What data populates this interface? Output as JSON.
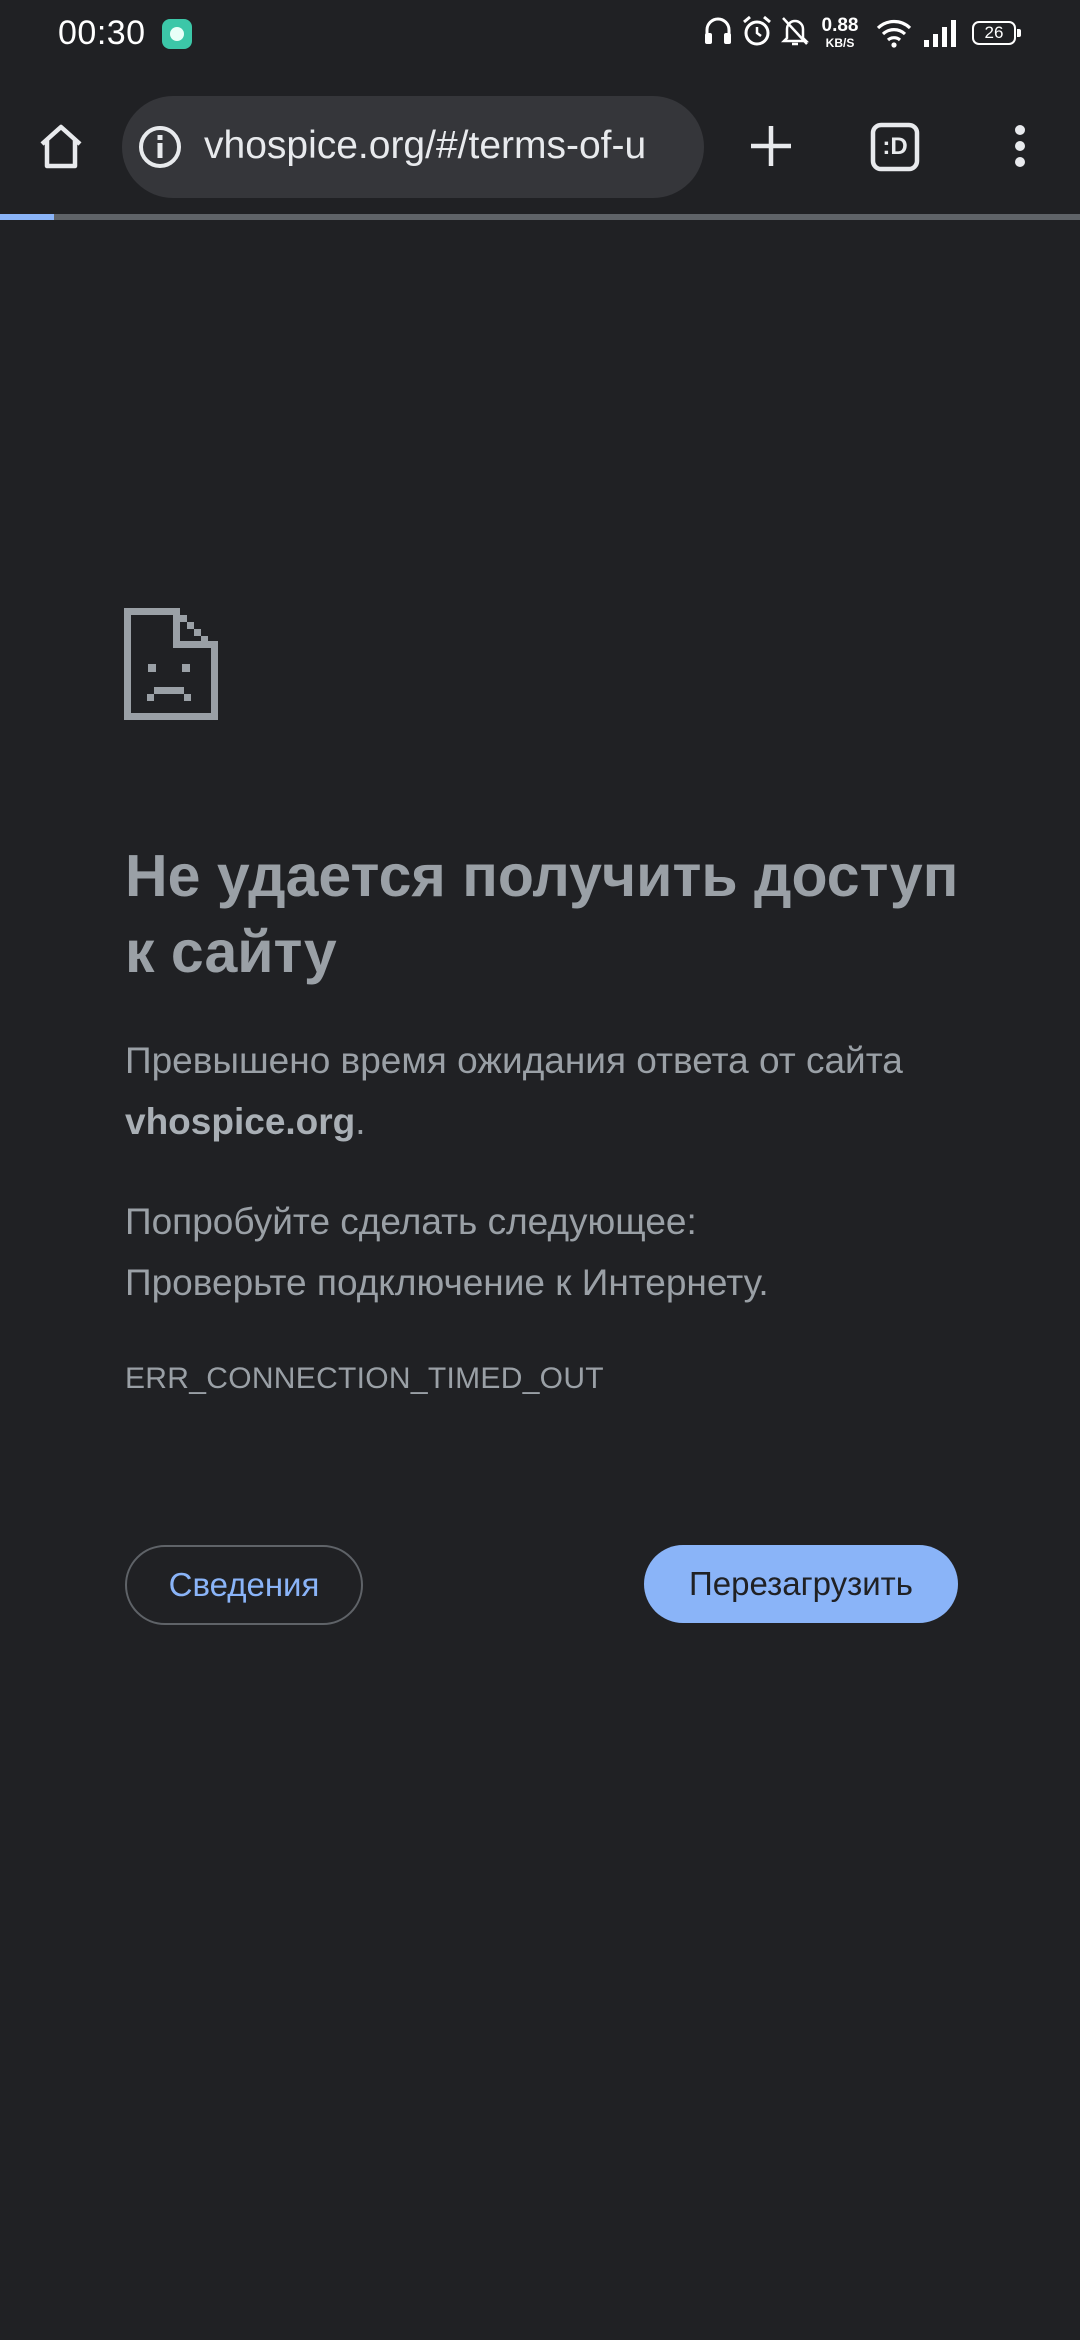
{
  "status_bar": {
    "time": "00:30",
    "net_speed_value": "0.88",
    "net_speed_unit": "KB/S",
    "battery": "26",
    "icons": [
      "chat-app-icon",
      "headphones-icon",
      "alarm-icon",
      "bell-off-icon",
      "wifi-icon",
      "signal-icon",
      "battery-icon"
    ]
  },
  "toolbar": {
    "url": "vhospice.org/#/terms-of-u",
    "tab_switcher_label": ":D",
    "icons": [
      "home-icon",
      "info-icon",
      "plus-icon",
      "tab-switcher-icon",
      "more-vert-icon"
    ]
  },
  "page_load_progress": 0.05,
  "error": {
    "icon": "sad-page-icon",
    "title": "Не удается получить доступ к сайту",
    "message_prefix": "Превышено время ожидания ответа от сайта",
    "site": "vhospice.org",
    "message_suffix": ".",
    "suggestion_heading": "Попробуйте сделать следующее:",
    "suggestion": "Проверьте подключение к Интернету.",
    "code": "ERR_CONNECTION_TIMED_OUT"
  },
  "buttons": {
    "details": "Сведения",
    "reload": "Перезагрузить"
  },
  "colors": {
    "background": "#202124",
    "accent": "#8ab4f8",
    "text_muted": "#9aa0a6"
  }
}
